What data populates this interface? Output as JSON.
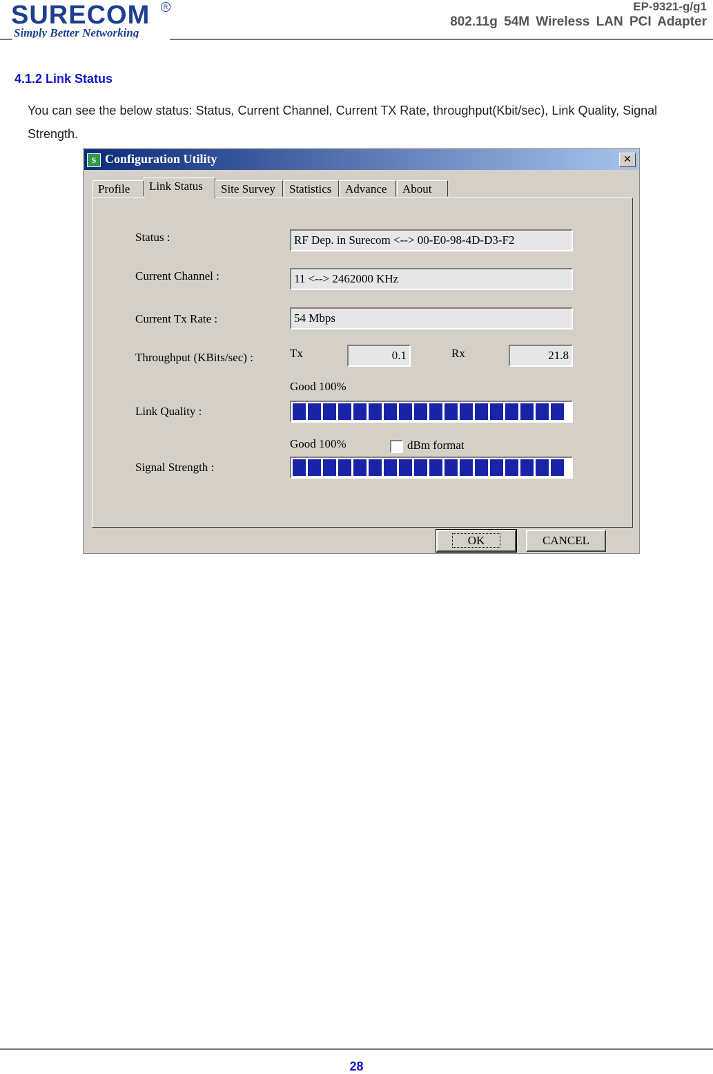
{
  "header": {
    "logo_word": "SURECOM",
    "logo_tagline": "Simply Better Networking",
    "model": "EP-9321-g/g1",
    "product": "802.11g 54M Wireless LAN PCI Adapter"
  },
  "section": {
    "title": "4.1.2 Link Status",
    "description": "You can see the below status: Status, Current Channel, Current TX Rate, throughput(Kbit/sec), Link Quality, Signal Strength."
  },
  "dialog": {
    "title": "Configuration Utility",
    "close_glyph": "✕",
    "tabs": [
      "Profile",
      "Link Status",
      "Site Survey",
      "Statistics",
      "Advance",
      "About"
    ],
    "active_tab": "Link Status",
    "status_label": "Status :",
    "status_value": "RF Dep. in Surecom <--> 00-E0-98-4D-D3-F2",
    "channel_label": "Current Channel :",
    "channel_value": "11 <--> 2462000 KHz",
    "txrate_label": "Current Tx Rate :",
    "txrate_value": "54 Mbps",
    "throughput_label": "Throughput (KBits/sec) :",
    "tx_label": "Tx",
    "tx_value": "0.1",
    "rx_label": "Rx",
    "rx_value": "21.8",
    "link_quality_label": "Link Quality :",
    "link_quality_text": "Good 100%",
    "link_quality_percent": 100,
    "signal_strength_label": "Signal Strength :",
    "signal_strength_text": "Good 100%",
    "signal_strength_percent": 100,
    "dbm_label": "dBm format",
    "dbm_checked": false,
    "ok_label": "OK",
    "cancel_label": "CANCEL"
  },
  "footer": {
    "page_number": "28"
  },
  "colors": {
    "section_title": "#1515c8",
    "bar_fill": "#1a22a8",
    "logo": "#1e3f8f"
  }
}
